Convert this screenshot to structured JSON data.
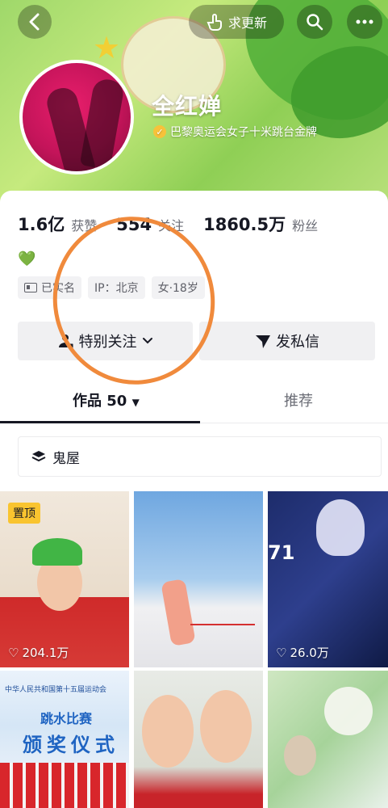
{
  "header": {
    "update_label": "求更新",
    "profile_name": "全红婵",
    "verified_text": "巴黎奥运会女子十米跳台金牌"
  },
  "stats": [
    {
      "value": "1.6亿",
      "label": "获赞"
    },
    {
      "value": "554",
      "label": "关注"
    },
    {
      "value": "1860.5万",
      "label": "粉丝"
    }
  ],
  "bio_emoji": "💚",
  "tags": [
    {
      "icon": "id-card-icon",
      "label": "已实名"
    },
    {
      "label": "IP：北京"
    },
    {
      "label": "女·18岁"
    }
  ],
  "buttons": {
    "follow_label": "特别关注",
    "message_label": "发私信"
  },
  "tabs": {
    "works_label": "作品 50",
    "recommend_label": "推荐"
  },
  "collection": {
    "label": "鬼屋"
  },
  "videos": [
    {
      "pinned_label": "置顶",
      "likes": "204.1万"
    },
    {
      "likes": ""
    },
    {
      "likes": "26.0万"
    },
    {
      "caption_line1": "中华人民共和国第十五届运动会",
      "caption_line2": "跳水比赛",
      "caption_line3": "颁奖仪式"
    },
    {},
    {}
  ],
  "colors": {
    "annotation": "#f08a3c",
    "pin_bg": "#f9c42f",
    "heart_green": "#4cc763"
  }
}
